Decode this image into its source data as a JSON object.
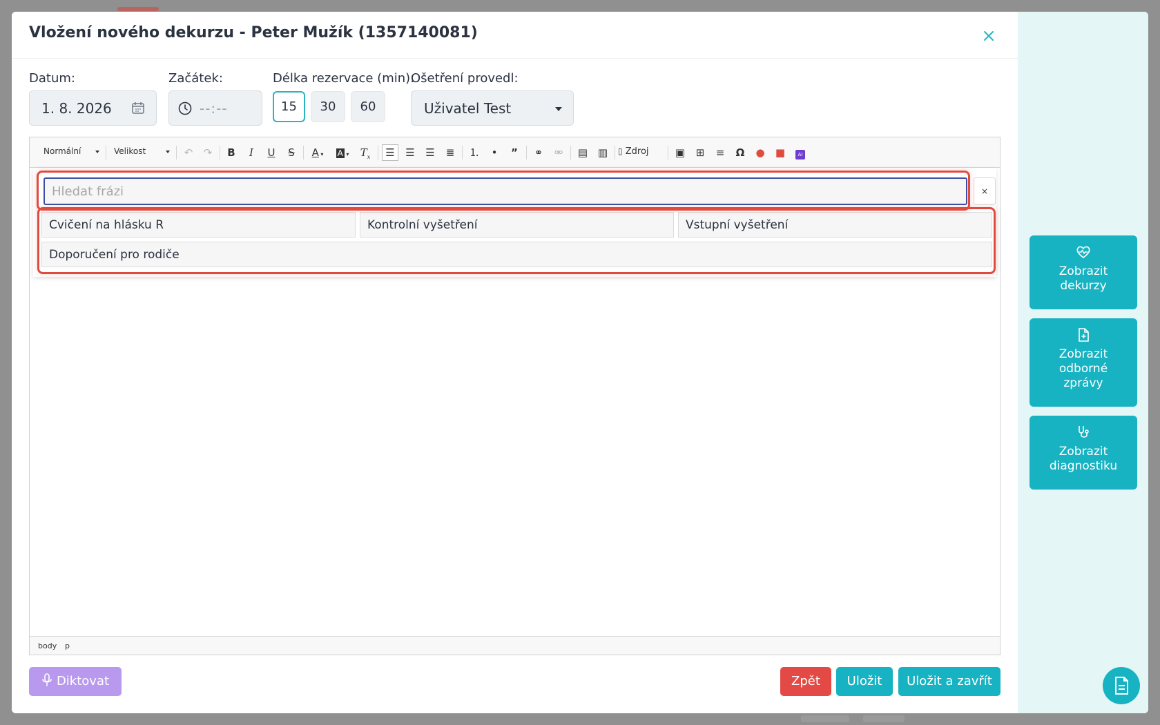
{
  "modal": {
    "title": "Vložení nového dekurzu - Peter Mužík (1357140081)"
  },
  "form": {
    "date_label": "Datum:",
    "date_value": "1. 8. 2026",
    "start_label": "Začátek:",
    "start_value": "--:--",
    "duration_label": "Délka rezervace (min):",
    "duration_options": [
      "15",
      "30",
      "60"
    ],
    "duration_selected": "15",
    "performed_label": "Ošetření provedl:",
    "performed_value": "Uživatel Test"
  },
  "toolbar": {
    "format_select": "Normální",
    "size_select": "Velikost",
    "source_label": "Zdroj"
  },
  "phrases": {
    "search_placeholder": "Hledat frázi",
    "clear_label": "×",
    "items": [
      "Cvičení na hlásku R",
      "Kontrolní vyšetření",
      "Vstupní vyšetření",
      "Doporučení pro rodiče"
    ]
  },
  "path_bar": [
    "body",
    "p"
  ],
  "footer": {
    "dictate_label": "Diktovat",
    "back_label": "Zpět",
    "save_label": "Uložit",
    "save_close_label": "Uložit a zavřít"
  },
  "side_panel": {
    "buttons": [
      {
        "label": "Zobrazit\ndekurzy",
        "icon": "heart-pulse-icon"
      },
      {
        "label": "Zobrazit\nodborné\nzprávy",
        "icon": "document-plus-icon"
      },
      {
        "label": "Zobrazit\ndiagnostiku",
        "icon": "stethoscope-icon"
      }
    ]
  },
  "colors": {
    "accent": "#17b3c2",
    "danger": "#e34a45",
    "dictate": "#b999ee",
    "highlight": "#e04b40",
    "side_panel_bg": "#e4f6f6"
  }
}
